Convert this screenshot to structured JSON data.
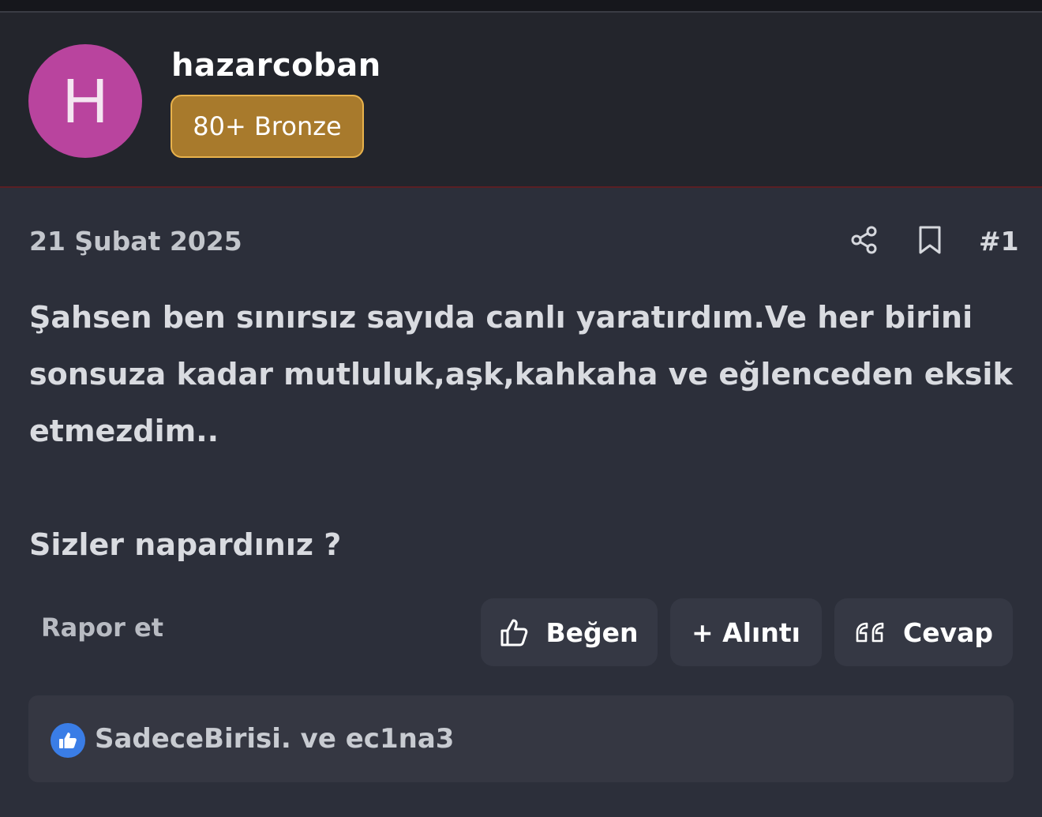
{
  "header": {
    "avatar_letter": "H",
    "avatar_color": "#b9449e",
    "username": "hazarcoban",
    "badge": "80+ Bronze",
    "badge_color": "#a87a2c"
  },
  "post": {
    "date": "21 Şubat 2025",
    "number": "#1",
    "icons": {
      "share": "share-icon",
      "bookmark": "bookmark-icon"
    },
    "lines": [
      "Şahsen ben sınırsız sayıda canlı yaratırdım.Ve her birini",
      "sonsuza kadar mutluluk,aşk,kahkaha ve eğlenceden eksik",
      "etmezdim.."
    ],
    "closing": "Sizler napardınız ?"
  },
  "actions": {
    "report": "Rapor et",
    "like": "Beğen",
    "quote": "+ Alıntı",
    "reply": "Cevap"
  },
  "reactions": {
    "text": "SadeceBirisi. ve ec1na3",
    "icon": "thumbs-up-icon",
    "color": "#3a7de6"
  }
}
